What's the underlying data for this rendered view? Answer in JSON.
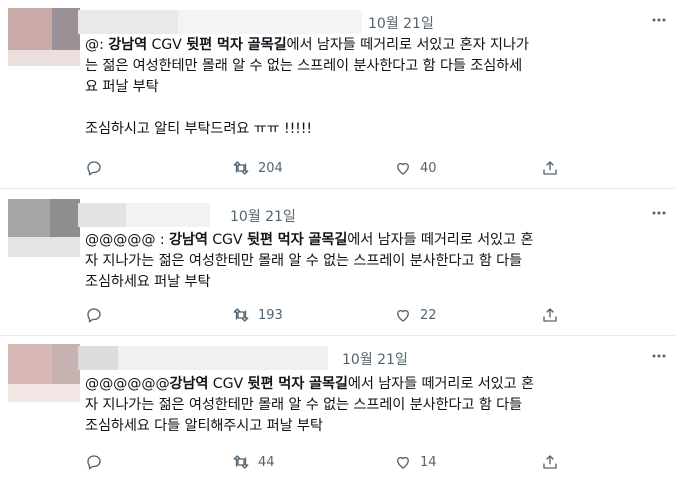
{
  "tweets": [
    {
      "date": "10월 21일",
      "lines": [
        "@: 강남역 CGV 뒷편 먹자 골목길에서 남자들 떼거리로 서있고 혼자 지나가",
        "는 젊은 여성한테만 몰래 알 수 없는 스프레이 분사한다고 함 다들 조심하세",
        "요 퍼날 부탁",
        "",
        "조심하시고 알티 부탁드려요 ㅠㅠ !!!!!"
      ],
      "retweet_count": "204",
      "like_count": "40"
    },
    {
      "date": "10월 21일",
      "lines": [
        "@@@@@ : 강남역 CGV 뒷편 먹자 골목길에서 남자들 떼거리로 서있고 혼",
        "자 지나가는 젊은 여성한테만 몰래 알 수 없는 스프레이 분사한다고 함 다들",
        "조심하세요 퍼날 부탁"
      ],
      "retweet_count": "193",
      "like_count": "22"
    },
    {
      "date": "10월 21일",
      "lines": [
        "@@@@@@강남역 CGV 뒷편 먹자 골목길에서 남자들 떼거리로 서있고 혼",
        "자 지나가는 젊은 여성한테만 몰래 알 수 없는 스프레이 분사한다고 함 다들",
        "조심하세요 다들 알티해주시고 퍼날 부탁"
      ],
      "retweet_count": "44",
      "like_count": "14"
    }
  ],
  "colors": {
    "text": "#0f1419",
    "muted": "#536471",
    "divider": "#e6ecf0"
  },
  "icons": [
    "reply-icon",
    "retweet-icon",
    "like-icon",
    "share-icon",
    "more-icon"
  ]
}
